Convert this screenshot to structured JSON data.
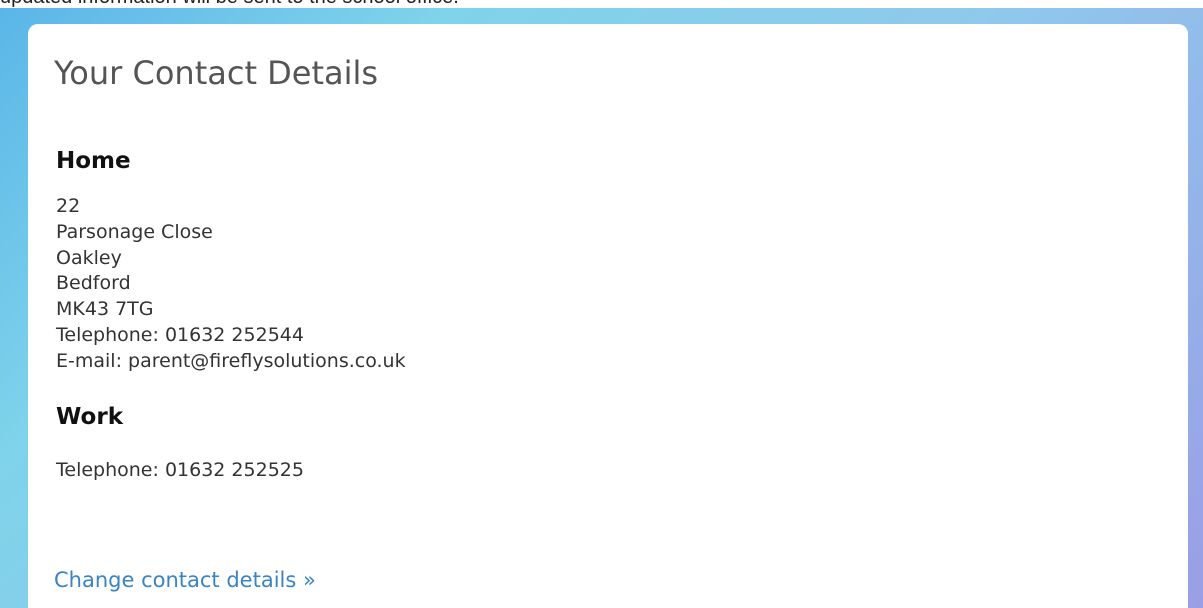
{
  "top_strip_text": "updated information will be sent to the school office.",
  "card": {
    "title": "Your Contact Details",
    "home": {
      "heading": "Home",
      "address_lines": [
        "22",
        "Parsonage Close",
        "Oakley",
        "Bedford",
        "MK43 7TG"
      ],
      "telephone_label": "Telephone:",
      "telephone": "01632 252544",
      "email_label": "E-mail:",
      "email": "parent@fireflysolutions.co.uk"
    },
    "work": {
      "heading": "Work",
      "telephone_label": "Telephone:",
      "telephone": "01632 252525"
    },
    "change_link": "Change contact details »"
  },
  "colors": {
    "link": "#3a84c3",
    "background_gradient_start": "#5ab6e8",
    "background_gradient_end": "#9a9ee6"
  }
}
